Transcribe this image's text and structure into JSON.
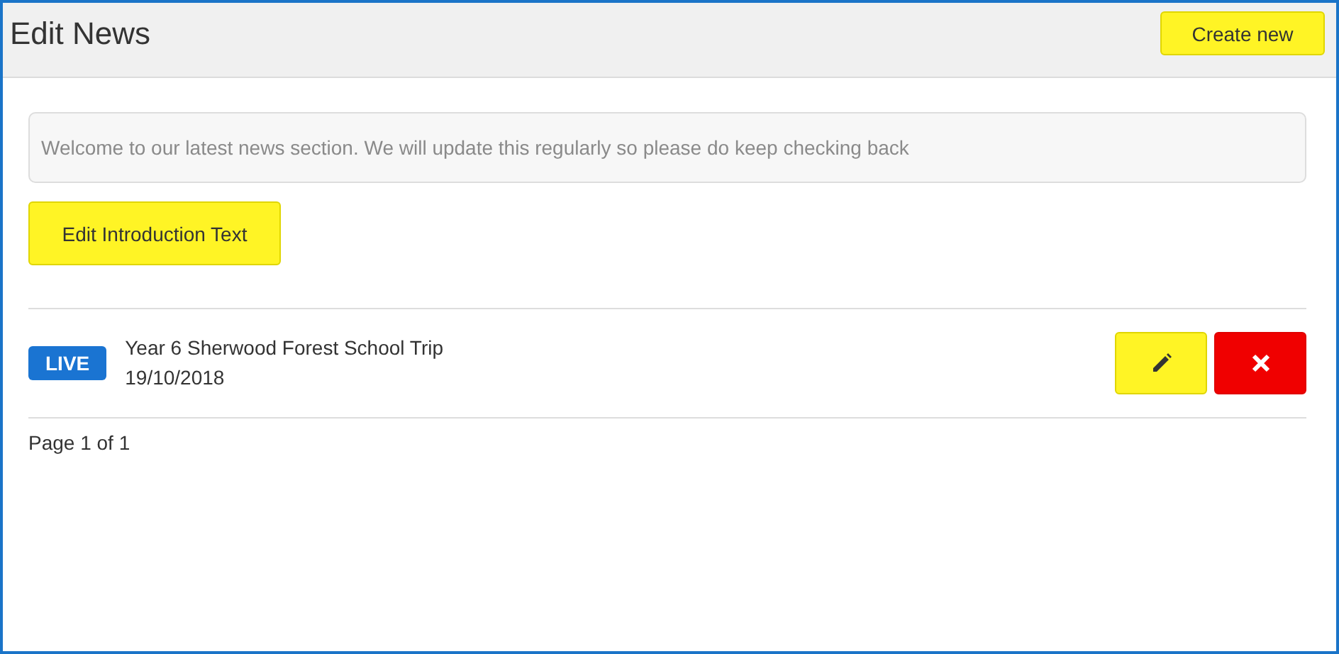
{
  "header": {
    "title": "Edit News",
    "create_button": "Create new"
  },
  "intro": {
    "text": "Welcome to our latest news section. We will update this regularly so please do keep checking back",
    "edit_button": "Edit Introduction Text"
  },
  "news_items": [
    {
      "status": "LIVE",
      "title": "Year 6 Sherwood Forest School Trip",
      "date": "19/10/2018"
    }
  ],
  "pagination": "Page 1 of 1"
}
